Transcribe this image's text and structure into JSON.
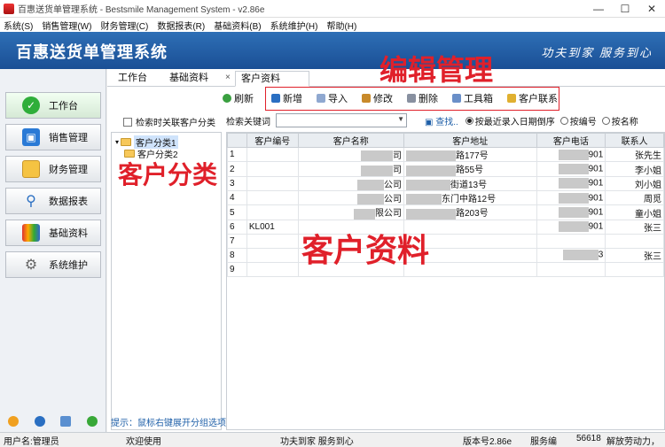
{
  "window": {
    "title": "百惠送货单管理系统 - Bestsmile Management System - v2.86e"
  },
  "menu": [
    "系统(S)",
    "销售管理(W)",
    "财务管理(C)",
    "数据报表(R)",
    "基础资料(B)",
    "系统维护(H)",
    "帮助(H)"
  ],
  "banner": {
    "brand": "百惠送货单管理系统",
    "slogan": "功夫到家  服务到心"
  },
  "sidebar": {
    "items": [
      {
        "label": "工作台"
      },
      {
        "label": "销售管理"
      },
      {
        "label": "财务管理"
      },
      {
        "label": "数据报表"
      },
      {
        "label": "基础资料"
      },
      {
        "label": "系统维护"
      }
    ]
  },
  "tabs": [
    {
      "label": "工作台"
    },
    {
      "label": "基础资料"
    },
    {
      "label": "客户资料"
    }
  ],
  "toolbar": [
    "刷新",
    "新增",
    "导入",
    "修改",
    "删除",
    "工具箱",
    "客户联系"
  ],
  "tree": {
    "check_label": "检索时关联客户分类",
    "nodes": [
      "客户分类1",
      "客户分类2"
    ],
    "hint": "提示：鼠标右键展开分组选项"
  },
  "search": {
    "label": "检索关键词",
    "find": "查找..",
    "options": [
      "按最近录入日期倒序",
      "按编号",
      "按名称"
    ]
  },
  "grid": {
    "columns": [
      "客户编号",
      "客户名称",
      "客户地址",
      "客户电话",
      "联系人"
    ],
    "rows": [
      {
        "n": "1",
        "code": "",
        "name": "司",
        "addr": "路177号",
        "tel": "901",
        "contact": "张先生"
      },
      {
        "n": "2",
        "code": "",
        "name": "司",
        "addr": "路55号",
        "tel": "901",
        "contact": "李小姐"
      },
      {
        "n": "3",
        "code": "",
        "name": "公司",
        "addr": "街道13号",
        "tel": "901",
        "contact": "刘小姐"
      },
      {
        "n": "4",
        "code": "",
        "name": "公司",
        "addr": "东门中路12号",
        "tel": "901",
        "contact": "周觅"
      },
      {
        "n": "5",
        "code": "",
        "name": "限公司",
        "addr": "路203号",
        "tel": "901",
        "contact": "童小姐"
      },
      {
        "n": "6",
        "code": "KL001",
        "name": "",
        "addr": "",
        "tel": "901",
        "contact": "张三"
      },
      {
        "n": "7",
        "code": "",
        "name": "",
        "addr": "",
        "tel": "",
        "contact": ""
      },
      {
        "n": "8",
        "code": "",
        "name": "",
        "addr": "",
        "tel": "3",
        "contact": "张三"
      },
      {
        "n": "9",
        "code": "",
        "name": "",
        "addr": "",
        "tel": "",
        "contact": ""
      }
    ]
  },
  "annotations": {
    "edit": "编辑管理",
    "category": "客户分类",
    "data": "客户资料"
  },
  "status": {
    "user": "用户名:管理员",
    "welcome": "欢迎使用",
    "motto": "功夫到家 服务到心",
    "version": "版本号2.86e",
    "service": "服务编",
    "code": "56618",
    "tail": "解放劳动力，"
  },
  "colors": {
    "banner": "#1a4f95",
    "annotation": "#e0202a",
    "link": "#1e5fa8"
  }
}
